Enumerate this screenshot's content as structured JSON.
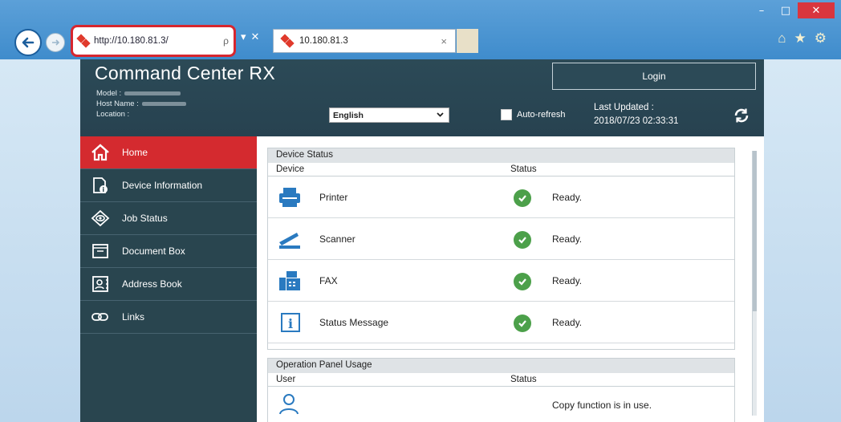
{
  "browser": {
    "address_url": "http://10.180.81.3/",
    "tab_title": "10.180.81.3",
    "tab_close": "×",
    "search_glyph": "ρ",
    "dropdown_glyph": "▾",
    "stop_glyph": "✕",
    "window_minimize": "–",
    "window_restore": "□",
    "window_close": "✕",
    "home_glyph": "⌂",
    "fav_glyph": "★",
    "settings_glyph": "⚙"
  },
  "header": {
    "app_title": "Command Center RX",
    "model_label": "Model :",
    "host_label": "Host Name :",
    "location_label": "Location :",
    "login_label": "Login",
    "language_value": "English",
    "auto_refresh_label": "Auto-refresh",
    "last_updated_label": "Last Updated :",
    "last_updated_value": "2018/07/23 02:33:31"
  },
  "sidebar": {
    "items": [
      {
        "label": "Home",
        "icon": "home-icon"
      },
      {
        "label": "Device Information",
        "icon": "device-info-icon"
      },
      {
        "label": "Job Status",
        "icon": "job-status-icon"
      },
      {
        "label": "Document Box",
        "icon": "document-box-icon"
      },
      {
        "label": "Address Book",
        "icon": "address-book-icon"
      },
      {
        "label": "Links",
        "icon": "links-icon"
      }
    ]
  },
  "device_status": {
    "title": "Device Status",
    "col_device": "Device",
    "col_status": "Status",
    "rows": [
      {
        "name": "Printer",
        "status": "Ready.",
        "icon": "printer-icon"
      },
      {
        "name": "Scanner",
        "status": "Ready.",
        "icon": "scanner-icon"
      },
      {
        "name": "FAX",
        "status": "Ready.",
        "icon": "fax-icon"
      },
      {
        "name": "Status Message",
        "status": "Ready.",
        "icon": "info-icon"
      }
    ]
  },
  "operation_panel": {
    "title": "Operation Panel Usage",
    "col_user": "User",
    "col_status": "Status",
    "rows": [
      {
        "status": "Copy function is in use.",
        "icon": "user-icon"
      }
    ]
  },
  "colors": {
    "accent_red": "#d42a2f",
    "header_bg": "#2c4a57",
    "status_green": "#4ca04a"
  }
}
